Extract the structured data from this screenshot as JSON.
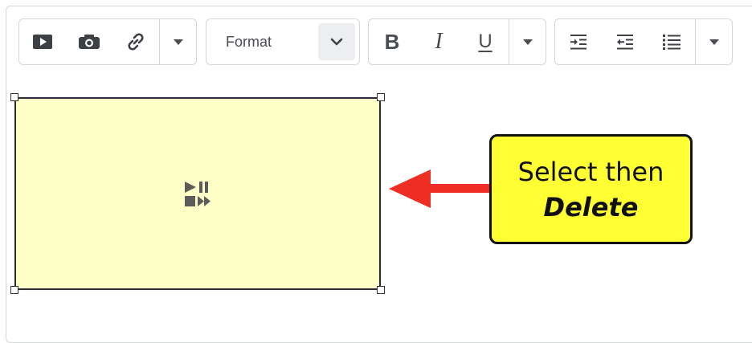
{
  "toolbar": {
    "insert_group": {
      "icons": [
        "video-icon",
        "camera-icon",
        "link-icon",
        "caret-down-icon"
      ]
    },
    "format_select": {
      "selected": "Format",
      "icon": "chevron-down-icon"
    },
    "text_style_group": {
      "bold_label": "B",
      "italic_label": "I",
      "underline_label": "U",
      "more_icon": "caret-down-icon"
    },
    "paragraph_group": {
      "icons": [
        "indent-icon",
        "outdent-icon",
        "bulleted-list-icon",
        "caret-down-icon"
      ]
    }
  },
  "canvas": {
    "media_placeholder": {
      "icon": "media-player-icon",
      "background": "#ffffc8"
    }
  },
  "callout": {
    "line1": "Select then",
    "line2": "Delete",
    "background": "#ffff33",
    "arrow_color": "#ee2e24"
  }
}
